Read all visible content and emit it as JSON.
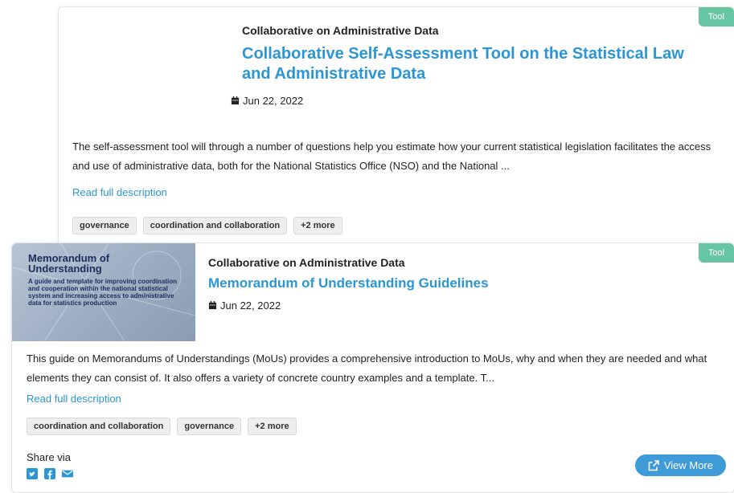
{
  "cards": [
    {
      "badge": "Tool",
      "organization": "Collaborative on Administrative Data",
      "title": "Collaborative Self-Assessment Tool on the Statistical Law and Administrative Data",
      "date": "Jun 22, 2022",
      "description": "The self-assessment tool will through a number of questions help you estimate how your current statistical legislation facilitates the access and use of administrative data, both for the National Statistics Office (NSO) and the National ...",
      "read_more": "Read full description",
      "tags": [
        "governance",
        "coordination and collaboration",
        "+2 more"
      ]
    },
    {
      "badge": "Tool",
      "organization": "Collaborative on Administrative Data",
      "title": "Memorandum of Understanding Guidelines",
      "date": "Jun 22, 2022",
      "thumbnail": {
        "title_line1": "Memorandum of",
        "title_line2": "Understanding",
        "subtitle": "A guide and template for improving coordination and cooperation within the national statistical system and increasing access to administrative data for statistics production"
      },
      "description": "This guide on Memorandums of Understandings (MoUs) provides a comprehensive introduction to MoUs, why and when they are needed and what elements they can consist of. It also offers a variety of concrete country examples and a template. T...",
      "read_more": "Read full description",
      "tags": [
        "coordination and collaboration",
        "governance",
        "+2 more"
      ],
      "share_label": "Share via",
      "view_more": "View More"
    }
  ],
  "colors": {
    "link": "#2b96d3",
    "badge": "#66c6a4",
    "button": "#3f9ad8"
  },
  "icons": [
    "calendar-icon",
    "twitter-icon",
    "facebook-icon",
    "email-icon",
    "external-link-icon"
  ]
}
